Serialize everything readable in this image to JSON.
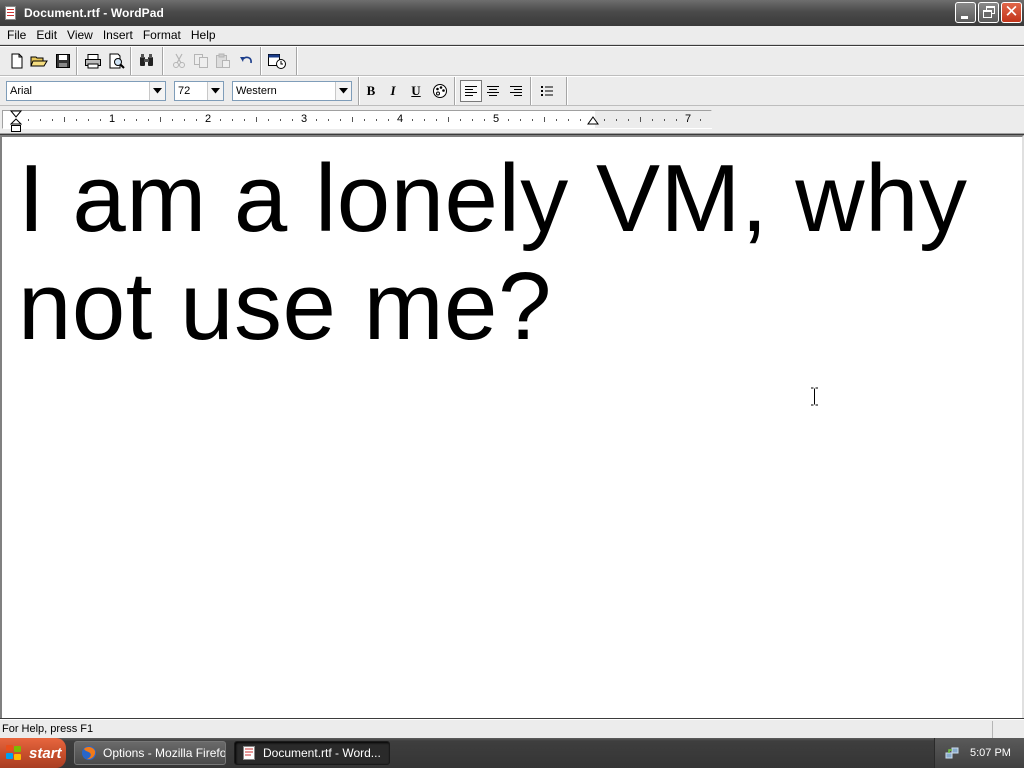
{
  "window": {
    "title": "Document.rtf - WordPad"
  },
  "menu": [
    "File",
    "Edit",
    "View",
    "Insert",
    "Format",
    "Help"
  ],
  "toolbar": {
    "icons": [
      "new-document-icon",
      "open-folder-icon",
      "save-icon",
      "print-icon",
      "print-preview-icon",
      "find-icon",
      "cut-icon",
      "copy-icon",
      "paste-icon",
      "undo-icon",
      "insert-datetime-icon"
    ]
  },
  "format_bar": {
    "font": "Arial",
    "size": "72",
    "script": "Western",
    "bold": "B",
    "italic": "I",
    "underline": "U",
    "alignment": "left"
  },
  "ruler": {
    "numbers": [
      "1",
      "2",
      "3",
      "4",
      "5",
      "7"
    ]
  },
  "document": {
    "text": "I am a lonely VM, why not use me?"
  },
  "status": {
    "text": "For Help, press F1"
  },
  "taskbar": {
    "start": "start",
    "items": [
      {
        "label": "Options - Mozilla Firefox",
        "active": false
      },
      {
        "label": "Document.rtf - Word...",
        "active": true
      }
    ],
    "clock": "5:07 PM"
  }
}
